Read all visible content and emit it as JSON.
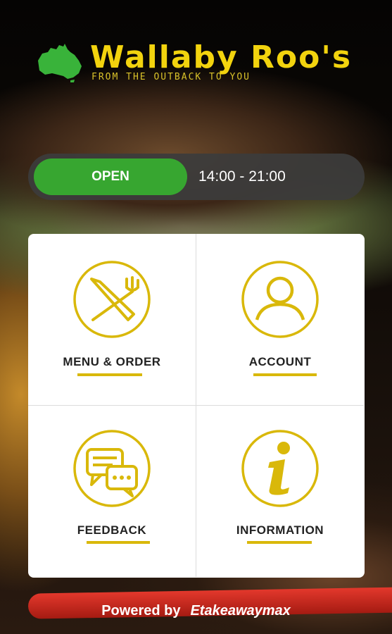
{
  "app": {
    "name": "Wallaby Roo's",
    "tagline": "FROM THE OUTBACK TO YOU"
  },
  "status": {
    "state": "OPEN",
    "hours": "14:00 - 21:00"
  },
  "tiles": [
    {
      "label": "MENU & ORDER",
      "icon": "cutlery-icon"
    },
    {
      "label": "ACCOUNT",
      "icon": "user-icon"
    },
    {
      "label": "FEEDBACK",
      "icon": "chat-bubbles-icon"
    },
    {
      "label": "INFORMATION",
      "icon": "info-icon"
    }
  ],
  "footer": {
    "powered_label": "Powered by",
    "brand": "Etakeawaymax"
  },
  "colors": {
    "accent": "#f2d30e",
    "open_green": "#37a630",
    "underline": "#d9b80a"
  }
}
